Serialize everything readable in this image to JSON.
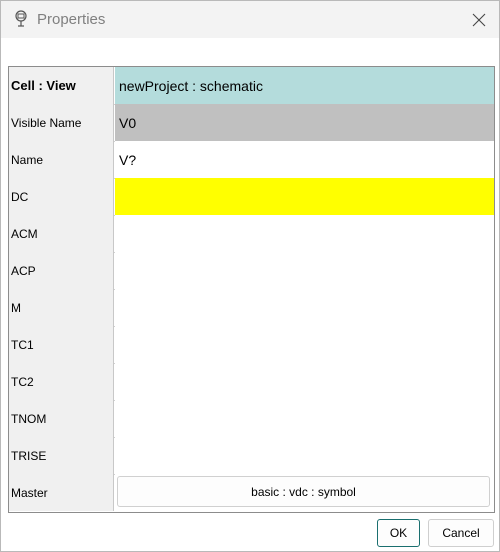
{
  "window": {
    "title": "Properties",
    "icon": "property-tag-icon",
    "close_icon": "close-icon"
  },
  "properties": [
    {
      "key": "cell_view",
      "label": "Cell : View",
      "value": "newProject : schematic",
      "style": "teal",
      "bold": true
    },
    {
      "key": "visible_name",
      "label": "Visible Name",
      "value": "V0",
      "style": "gray"
    },
    {
      "key": "name",
      "label": "Name",
      "value": "V?",
      "style": "white"
    },
    {
      "key": "dc",
      "label": "DC",
      "value": "",
      "style": "yellow"
    },
    {
      "key": "acm",
      "label": "ACM",
      "value": "",
      "style": "white"
    },
    {
      "key": "acp",
      "label": "ACP",
      "value": "",
      "style": "white"
    },
    {
      "key": "m",
      "label": "M",
      "value": "",
      "style": "white"
    },
    {
      "key": "tc1",
      "label": "TC1",
      "value": "",
      "style": "white"
    },
    {
      "key": "tc2",
      "label": "TC2",
      "value": "",
      "style": "white"
    },
    {
      "key": "tnom",
      "label": "TNOM",
      "value": "",
      "style": "white"
    },
    {
      "key": "trise",
      "label": "TRISE",
      "value": "",
      "style": "white"
    },
    {
      "key": "master",
      "label": "Master",
      "value": "basic : vdc : symbol",
      "style": "button"
    }
  ],
  "colors": {
    "teal": "#b4dcdc",
    "gray": "#c0c0c0",
    "yellow": "#ffff00",
    "ok_border": "#1a6f6f"
  },
  "buttons": {
    "ok": "OK",
    "cancel": "Cancel"
  }
}
